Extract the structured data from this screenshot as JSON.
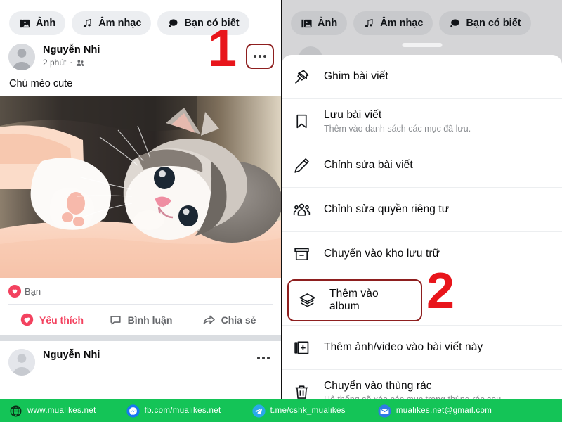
{
  "composer": {
    "chips": [
      {
        "label": "Ảnh",
        "icon": "photo-icon"
      },
      {
        "label": "Âm nhạc",
        "icon": "music-note-icon"
      },
      {
        "label": "Bạn có biết",
        "icon": "speech-bubble-icon"
      }
    ]
  },
  "post": {
    "author": "Nguyễn Nhi",
    "time": "2 phút",
    "separator": "·",
    "audience_icon": "friends-icon",
    "text": "Chú mèo cute",
    "more_icon": "ellipsis-icon",
    "photo_alt": "kitten-photo",
    "reactions": {
      "summary_label": "Bạn",
      "summary_icon": "heart-reaction-icon",
      "actions": [
        {
          "label": "Yêu thích",
          "icon": "heart-icon",
          "active": true
        },
        {
          "label": "Bình luận",
          "icon": "comment-icon",
          "active": false
        },
        {
          "label": "Chia sẻ",
          "icon": "share-icon",
          "active": false
        }
      ]
    }
  },
  "menu": {
    "items": [
      {
        "title": "Ghim bài viết",
        "desc": "",
        "icon": "pin-icon",
        "highlighted": false
      },
      {
        "title": "Lưu bài viết",
        "desc": "Thêm vào danh sách các mục đã lưu.",
        "icon": "bookmark-icon",
        "highlighted": false
      },
      {
        "title": "Chỉnh sửa bài viết",
        "desc": "",
        "icon": "pencil-icon",
        "highlighted": false
      },
      {
        "title": "Chỉnh sửa quyền riêng tư",
        "desc": "",
        "icon": "people-icon",
        "highlighted": false
      },
      {
        "title": "Chuyển vào kho lưu trữ",
        "desc": "",
        "icon": "archive-icon",
        "highlighted": false
      },
      {
        "title": "Thêm vào album",
        "desc": "",
        "icon": "layers-icon",
        "highlighted": true
      },
      {
        "title": "Thêm ảnh/video vào bài viết này",
        "desc": "",
        "icon": "add-media-icon",
        "highlighted": false
      },
      {
        "title": "Chuyển vào thùng rác",
        "desc": "Hệ thống sẽ xóa các mục trong thùng rác sau",
        "icon": "trash-icon",
        "highlighted": false
      }
    ]
  },
  "steps": {
    "one": "1",
    "two": "2"
  },
  "footer": {
    "items": [
      {
        "text": "www.mualikes.net",
        "icon": "globe-icon"
      },
      {
        "text": "fb.com/mualikes.net",
        "icon": "messenger-icon"
      },
      {
        "text": "t.me/cshk_mualikes",
        "icon": "telegram-icon"
      },
      {
        "text": "mualikes.net@gmail.com",
        "icon": "email-icon"
      }
    ]
  },
  "colors": {
    "banner_green": "#14c457",
    "accent_red": "#e8151b",
    "highlight_border": "#8e1f1f",
    "heart_red": "#f3425f",
    "chip_bg": "#eceef1"
  }
}
